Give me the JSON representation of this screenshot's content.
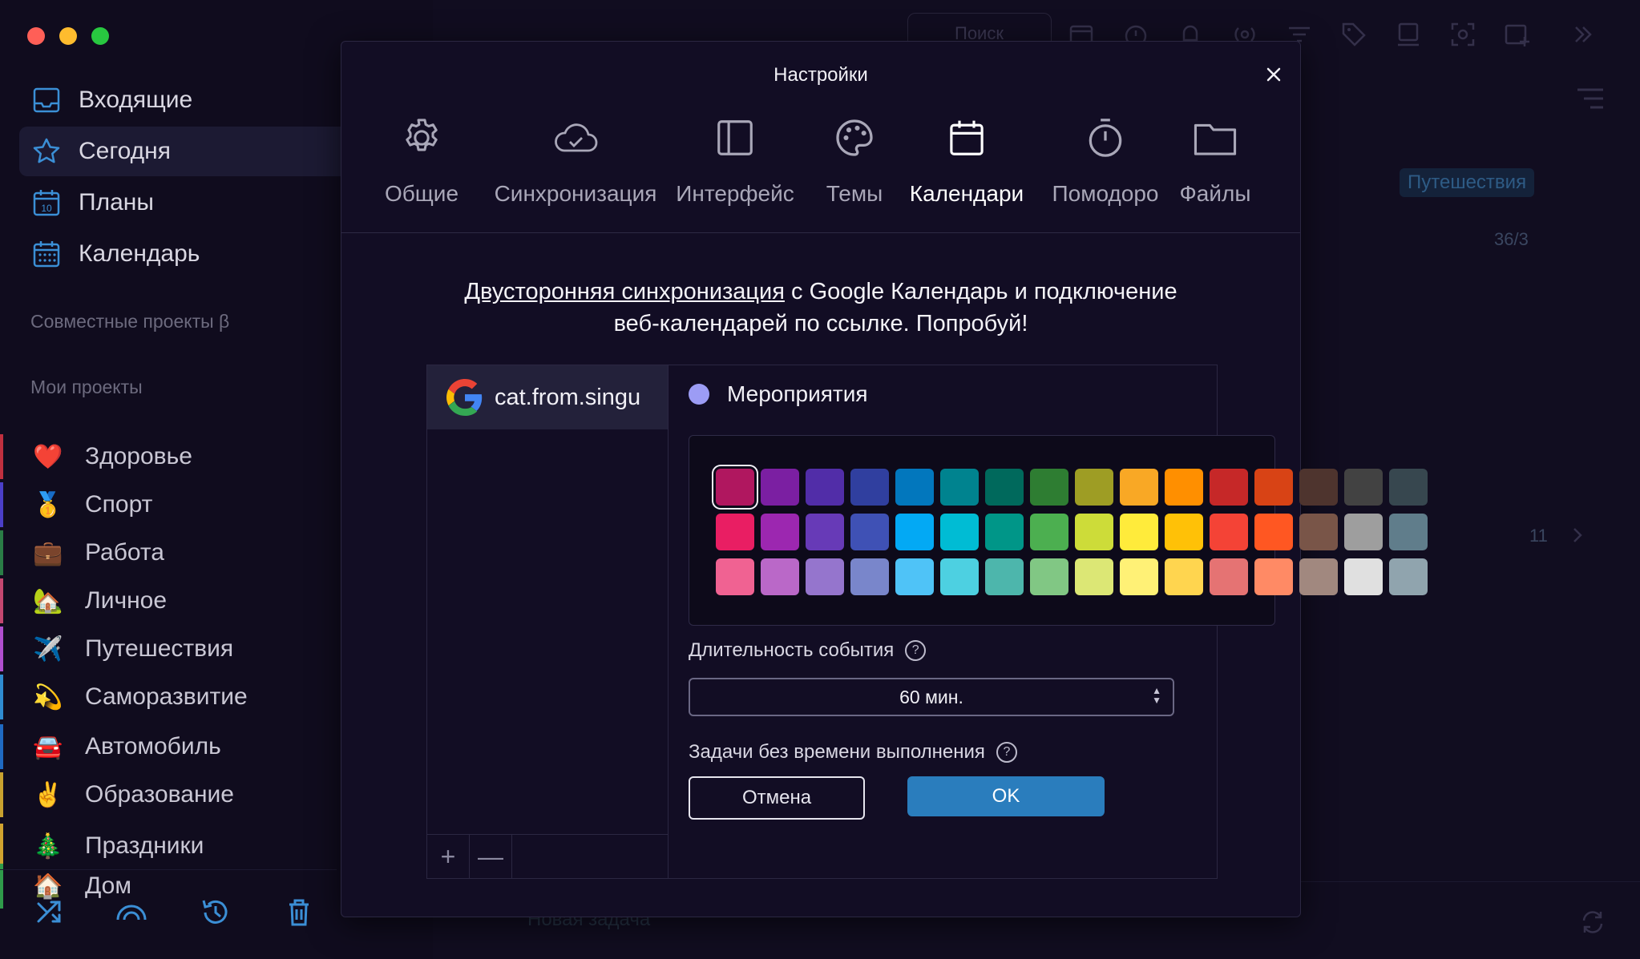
{
  "sidebar": {
    "nav": [
      {
        "label": "Входящие",
        "icon": "inbox-icon"
      },
      {
        "label": "Сегодня",
        "icon": "star-icon"
      },
      {
        "label": "Планы",
        "icon": "plans-calendar-icon"
      },
      {
        "label": "Календарь",
        "icon": "calendar-icon"
      }
    ],
    "shared_section": "Совместные проекты β",
    "my_section": "Мои проекты",
    "projects": [
      {
        "label": "Здоровье",
        "emoji": "❤️",
        "color": "#c0303f"
      },
      {
        "label": "Спорт",
        "emoji": "🥇",
        "color": "#4b3fc9"
      },
      {
        "label": "Работа",
        "emoji": "💼",
        "color": "#2a7d46"
      },
      {
        "label": "Личное",
        "emoji": "🏡",
        "color": "#c44770"
      },
      {
        "label": "Путешествия",
        "emoji": "✈️",
        "color": "#b04fcf"
      },
      {
        "label": "Саморазвитие",
        "emoji": "💫",
        "color": "#2f8cd1"
      },
      {
        "label": "Автомобиль",
        "emoji": "🚘",
        "color": "#1f6ac2"
      },
      {
        "label": "Образование",
        "emoji": "✌️",
        "color": "#c9a22f"
      },
      {
        "label": "Праздники",
        "emoji": "🎄",
        "color": "#d1a32f"
      },
      {
        "label": "Дом",
        "emoji": "🏠",
        "color": "#2f9b4a"
      }
    ]
  },
  "background": {
    "search_placeholder": "Поиск",
    "tag": "Путешествия",
    "counter": "36/3",
    "page": "11",
    "new_task": "Новая задача"
  },
  "modal": {
    "title": "Настройки",
    "tabs": [
      {
        "label": "Общие",
        "icon": "gear-icon"
      },
      {
        "label": "Синхронизация",
        "icon": "cloud-sync-icon"
      },
      {
        "label": "Интерфейс",
        "icon": "layout-icon"
      },
      {
        "label": "Темы",
        "icon": "palette-icon"
      },
      {
        "label": "Календари",
        "icon": "calendar-icon"
      },
      {
        "label": "Помодоро",
        "icon": "timer-icon"
      },
      {
        "label": "Файлы",
        "icon": "folder-icon"
      }
    ],
    "active_tab": "Календари",
    "promo_link": "Двусторонняя синхронизация",
    "promo_rest": " с Google Календарь и подключение",
    "promo_line2": "веб-календарей по ссылке. Попробуй!",
    "account_email": "cat.from.singu",
    "calendar_name": "Мероприятия",
    "calendar_color": "#9c9cf5",
    "add_label": "+",
    "remove_label": "—",
    "duration_label": "Длительность события",
    "duration_value": "60 мин.",
    "no_time_label": "Задачи без времени выполнения",
    "help_glyph": "?",
    "cancel_label": "Отмена",
    "ok_label": "OK",
    "close_label": "×"
  },
  "palette": {
    "selected": 0,
    "rows": [
      [
        "#b0175f",
        "#7b1fa2",
        "#512da8",
        "#303f9f",
        "#0277bd",
        "#00838f",
        "#00695c",
        "#2e7d32",
        "#9e9d24",
        "#f9a825",
        "#ff8f00",
        "#c62828",
        "#d84315",
        "#4e342e",
        "#424242",
        "#37474f"
      ],
      [
        "#e91e63",
        "#9c27b0",
        "#673ab7",
        "#3f51b5",
        "#03a9f4",
        "#00bcd4",
        "#009688",
        "#4caf50",
        "#cddc39",
        "#ffeb3b",
        "#ffc107",
        "#f44336",
        "#ff5722",
        "#795548",
        "#9e9e9e",
        "#607d8b"
      ],
      [
        "#f06292",
        "#ba68c8",
        "#9575cd",
        "#7986cb",
        "#4fc3f7",
        "#4dd0e1",
        "#4db6ac",
        "#81c784",
        "#dce775",
        "#fff176",
        "#ffd54f",
        "#e57373",
        "#ff8a65",
        "#a1887f",
        "#e0e0e0",
        "#90a4ae"
      ]
    ]
  }
}
